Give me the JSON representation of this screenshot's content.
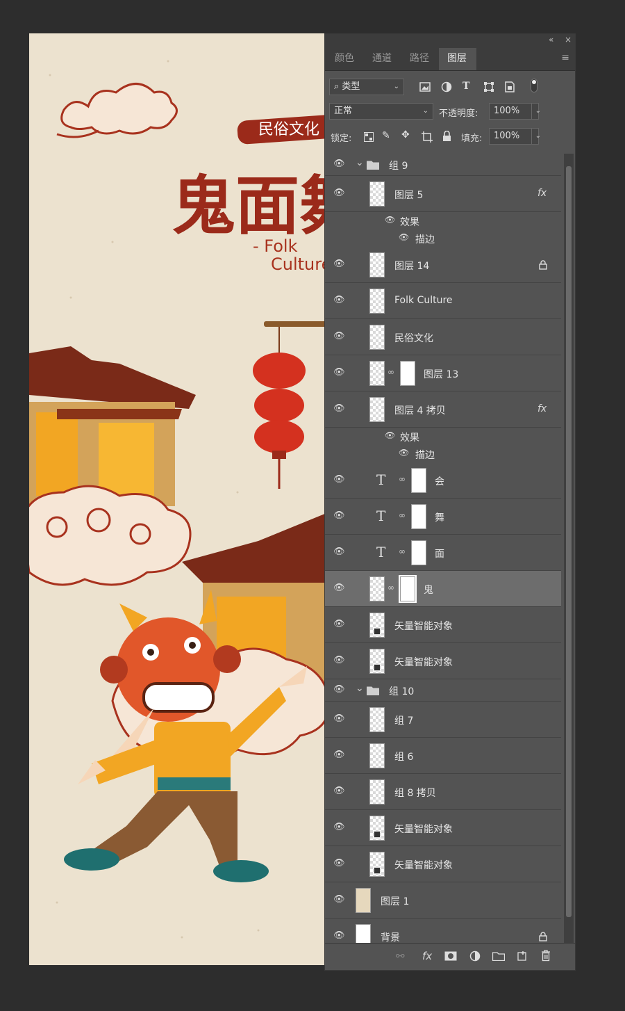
{
  "canvas": {
    "title_badge": "民俗文化",
    "title_main": "鬼面舞会",
    "subtitle_line1": "- Folk",
    "subtitle_line2": "Culture",
    "colors": {
      "paper": "#ece2cf",
      "title_red": "#9b2a1a",
      "lantern": "#d4311f",
      "roof": "#7a2a18",
      "cloud": "#f6e6d6"
    }
  },
  "panel": {
    "collapse_icon": "«",
    "close_icon": "×",
    "tabs": [
      "颜色",
      "通道",
      "路径",
      "图层"
    ],
    "active_tab": "图层",
    "menu_icon": "≡",
    "filter": {
      "label": "类型",
      "search_icon": "⌕",
      "icons": [
        "image-filter-icon",
        "adjustment-filter-icon",
        "type-filter-icon",
        "shape-filter-icon",
        "smart-object-filter-icon",
        "toggle-filter-icon"
      ]
    },
    "blend_mode": "正常",
    "opacity_label": "不透明度:",
    "opacity_value": "100%",
    "lock_label": "锁定:",
    "fill_label": "填充:",
    "fill_value": "100%",
    "layers": [
      {
        "name": "组 9",
        "kind": "group",
        "indent": 0
      },
      {
        "name": "图层 5",
        "kind": "layer",
        "indent": 1,
        "fx": true
      },
      {
        "name": "效果",
        "kind": "effect",
        "indent": 2
      },
      {
        "name": "描边",
        "kind": "effect",
        "indent": 3
      },
      {
        "name": "图层 14",
        "kind": "layer",
        "indent": 1,
        "locked": true
      },
      {
        "name": "Folk  Culture",
        "kind": "layer",
        "indent": 1
      },
      {
        "name": "民俗文化",
        "kind": "layer",
        "indent": 1
      },
      {
        "name": "图层 13",
        "kind": "masked",
        "indent": 1
      },
      {
        "name": "图层 4 拷贝",
        "kind": "layer",
        "indent": 1,
        "fx": true
      },
      {
        "name": "效果",
        "kind": "effect",
        "indent": 2
      },
      {
        "name": "描边",
        "kind": "effect",
        "indent": 3
      },
      {
        "name": "会",
        "kind": "text",
        "indent": 1
      },
      {
        "name": "舞",
        "kind": "text",
        "indent": 1
      },
      {
        "name": "面",
        "kind": "text",
        "indent": 1
      },
      {
        "name": "鬼",
        "kind": "masked",
        "indent": 1,
        "selected": true
      },
      {
        "name": "矢量智能对象",
        "kind": "smart",
        "indent": 1
      },
      {
        "name": "矢量智能对象",
        "kind": "smart",
        "indent": 1
      },
      {
        "name": "组 10",
        "kind": "group",
        "indent": 0
      },
      {
        "name": "组 7",
        "kind": "layer",
        "indent": 1
      },
      {
        "name": "组 6",
        "kind": "layer",
        "indent": 1
      },
      {
        "name": "组 8 拷贝",
        "kind": "layer",
        "indent": 1
      },
      {
        "name": "矢量智能对象",
        "kind": "smart",
        "indent": 1
      },
      {
        "name": "矢量智能对象",
        "kind": "smart",
        "indent": 1
      },
      {
        "name": "图层 1",
        "kind": "beige",
        "indent": 0
      },
      {
        "name": "背景",
        "kind": "background",
        "indent": 0,
        "locked": true
      }
    ],
    "bottom_icons": [
      "link-layers-icon",
      "fx-icon",
      "add-mask-icon",
      "adjustment-layer-icon",
      "new-group-icon",
      "new-layer-icon",
      "delete-icon"
    ]
  }
}
